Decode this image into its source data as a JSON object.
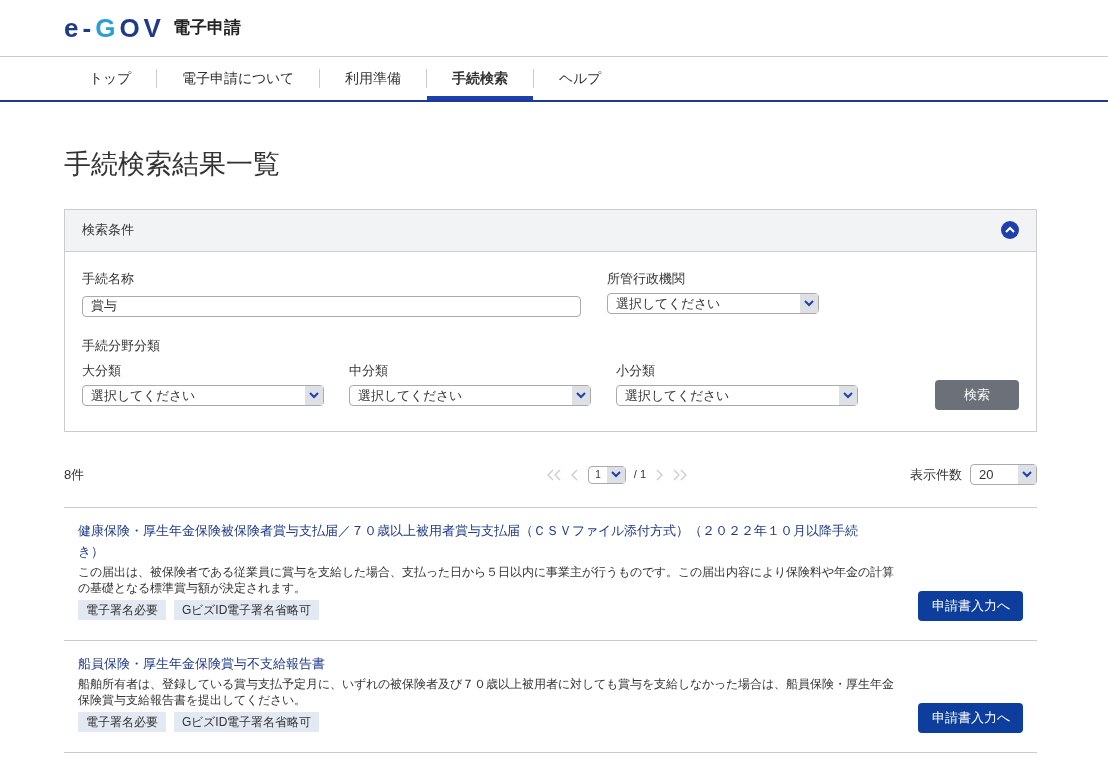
{
  "logo": {
    "parts": [
      {
        "text": "e",
        "color": "#1e3a8a"
      },
      {
        "text": "-",
        "color": "#1e3a8a"
      },
      {
        "text": "G",
        "color": "#2a9fd6"
      },
      {
        "text": "OV",
        "color": "#1e3a8a"
      }
    ],
    "subtitle": "電子申請"
  },
  "nav": [
    {
      "label": "トップ",
      "selected": false
    },
    {
      "label": "電子申請について",
      "selected": false
    },
    {
      "label": "利用準備",
      "selected": false
    },
    {
      "label": "手続検索",
      "selected": true
    },
    {
      "label": "ヘルプ",
      "selected": false
    }
  ],
  "page_title": "手続検索結果一覧",
  "search_panel": {
    "title": "検索条件",
    "expanded": true,
    "name_label": "手続名称",
    "name_value": "賞与",
    "agency_label": "所管行政機関",
    "agency_value": "選択してください",
    "category_label": "手続分野分類",
    "categories": [
      {
        "label": "大分類",
        "value": "選択してください"
      },
      {
        "label": "中分類",
        "value": "選択してください"
      },
      {
        "label": "小分類",
        "value": "選択してください"
      }
    ],
    "search_button": "検索"
  },
  "results_bar": {
    "count": "8件",
    "page": "1",
    "page_total": "/ 1",
    "per_page_label": "表示件数",
    "per_page": "20"
  },
  "results": [
    {
      "title": "健康保険・厚生年金保険被保険者賞与支払届／７０歳以上被用者賞与支払届（ＣＳＶファイル添付方式）（２０２２年１０月以降手続き）",
      "description": "この届出は、被保険者である従業員に賞与を支給した場合、支払った日から５日以内に事業主が行うものです。この届出内容により保険料や年金の計算の基礎となる標準賞与額が決定されます。",
      "tags": [
        "電子署名必要",
        "GビズID電子署名省略可"
      ],
      "button": "申請書入力へ"
    },
    {
      "title": "船員保険・厚生年金保険賞与不支給報告書",
      "description": "船舶所有者は、登録している賞与支払予定月に、いずれの被保険者及び７０歳以上被用者に対しても賞与を支給しなかった場合は、船員保険・厚生年金保険賞与支給報告書を提出してください。",
      "tags": [
        "電子署名必要",
        "GビズID電子署名省略可"
      ],
      "button": "申請書入力へ"
    }
  ]
}
